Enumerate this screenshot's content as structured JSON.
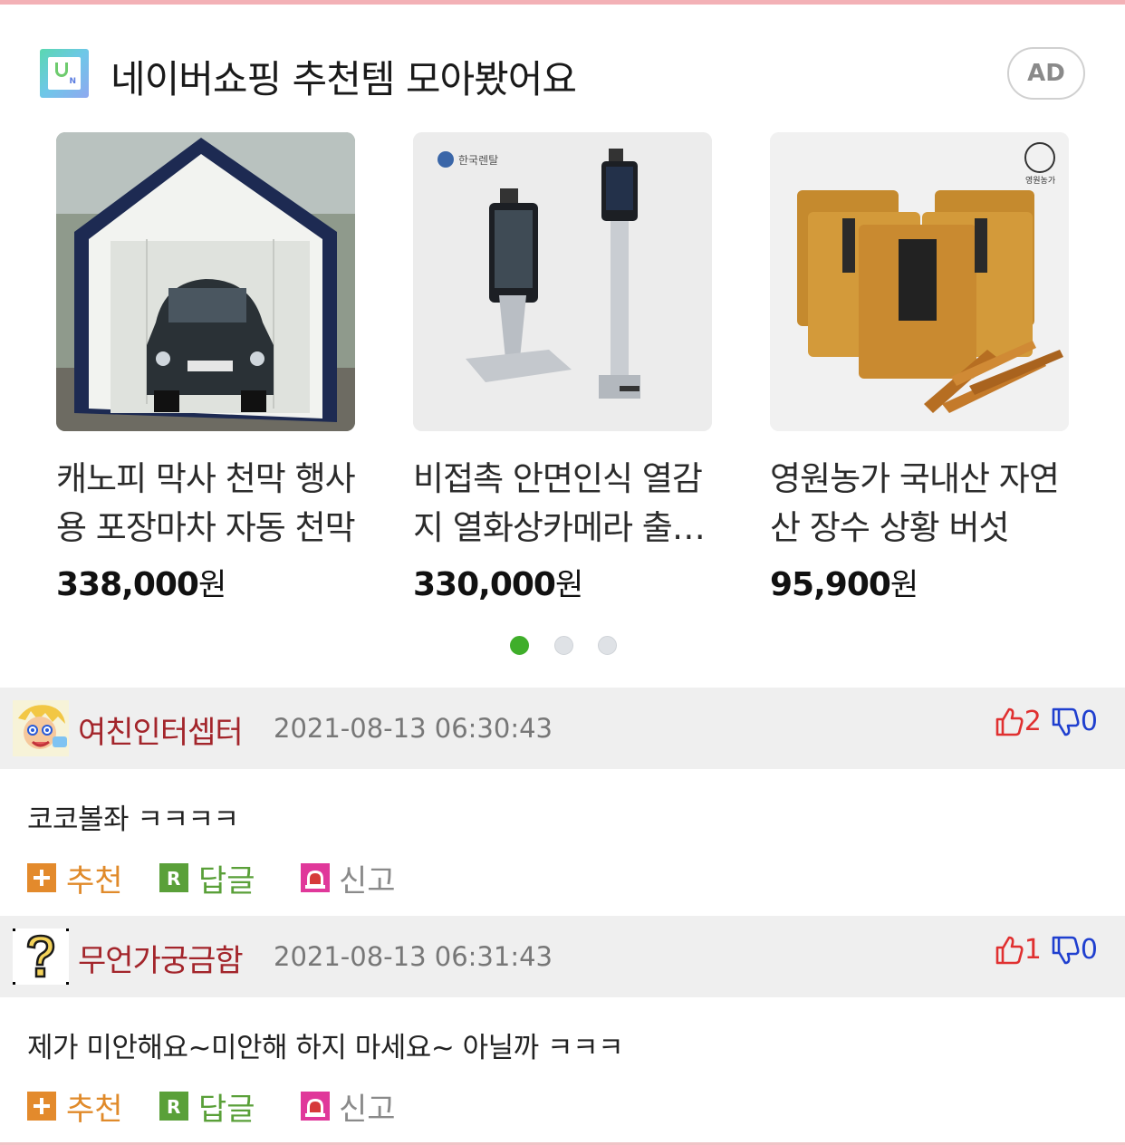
{
  "ad": {
    "title": "네이버쇼핑 추천템 모아봤어요",
    "badge": "AD",
    "brand_icon": "naver-shopping-icon",
    "products": [
      {
        "name": "캐노피 막사 천막 행사 용 포장마차 자동 천막",
        "price": "338,000",
        "unit": "원"
      },
      {
        "name": "비접촉 안면인식 열감지 열화상카메라 출입통제",
        "price": "330,000",
        "unit": "원"
      },
      {
        "name": "영원농가 국내산 자연산 장수 상황 버섯",
        "price": "95,900",
        "unit": "원"
      }
    ],
    "image_labels": {
      "rental": "한국렌탈",
      "farm": "영원농가"
    },
    "carousel": {
      "pages": 3,
      "active": 1,
      "active_color": "#3fae2a"
    }
  },
  "comments": [
    {
      "nickname": "여친인터셉터",
      "datetime": "2021-08-13 06:30:43",
      "upvotes": "2",
      "downvotes": "0",
      "text": "코코볼좌 ㅋㅋㅋㅋ",
      "actions": {
        "recommend": "추천",
        "reply": "답글",
        "report": "신고"
      }
    },
    {
      "nickname": "무언가궁금함",
      "datetime": "2021-08-13 06:31:43",
      "upvotes": "1",
      "downvotes": "0",
      "text": "제가 미안해요~미안해 하지 마세요~ 아닐까 ㅋㅋㅋ",
      "actions": {
        "recommend": "추천",
        "reply": "답글",
        "report": "신고"
      }
    }
  ],
  "colors": {
    "nickname": "#a3252b",
    "upvote": "#e03030",
    "downvote": "#1f3fcf",
    "recommend": "#e08a2a",
    "reply": "#5aa039",
    "report_icon": "#e0389a"
  }
}
